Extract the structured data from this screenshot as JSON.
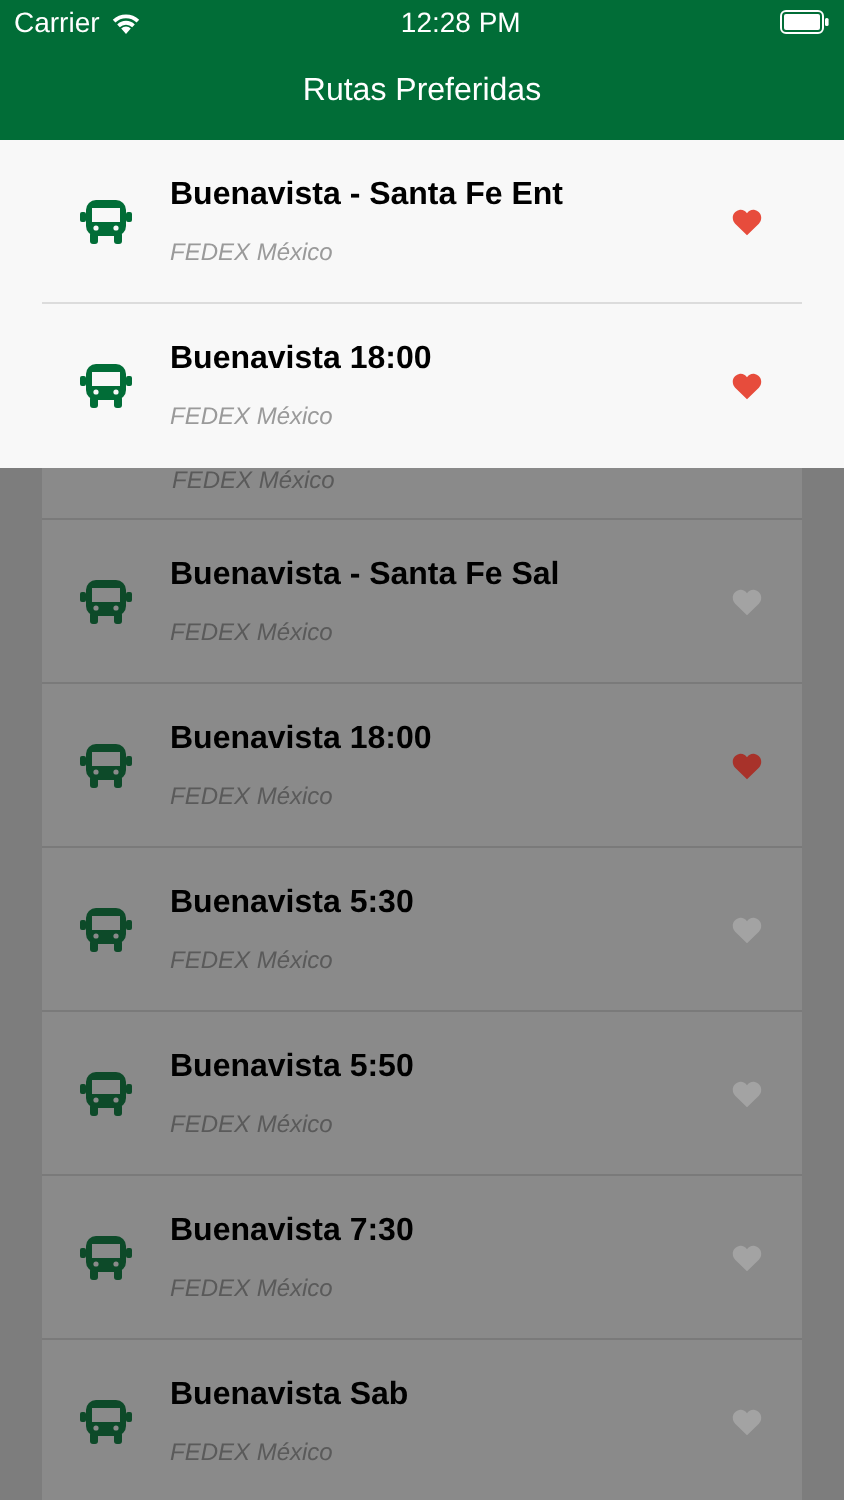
{
  "status_bar": {
    "carrier": "Carrier",
    "time": "12:28 PM"
  },
  "nav": {
    "title": "Rutas Preferidas"
  },
  "favorites_panel": {
    "routes": [
      {
        "name": "Buenavista - Santa Fe Ent",
        "company": "FEDEX México",
        "favorite": true
      },
      {
        "name": "Buenavista 18:00",
        "company": "FEDEX México",
        "favorite": true
      }
    ]
  },
  "routes": [
    {
      "company": "FEDEX México"
    },
    {
      "name": "Buenavista - Santa Fe Sal",
      "company": "FEDEX México",
      "favorite": false
    },
    {
      "name": "Buenavista 18:00",
      "company": "FEDEX México",
      "favorite": true
    },
    {
      "name": "Buenavista 5:30",
      "company": "FEDEX México",
      "favorite": false
    },
    {
      "name": "Buenavista 5:50",
      "company": "FEDEX México",
      "favorite": false
    },
    {
      "name": "Buenavista 7:30",
      "company": "FEDEX México",
      "favorite": false
    },
    {
      "name": "Buenavista Sab",
      "company": "FEDEX México",
      "favorite": false
    }
  ]
}
